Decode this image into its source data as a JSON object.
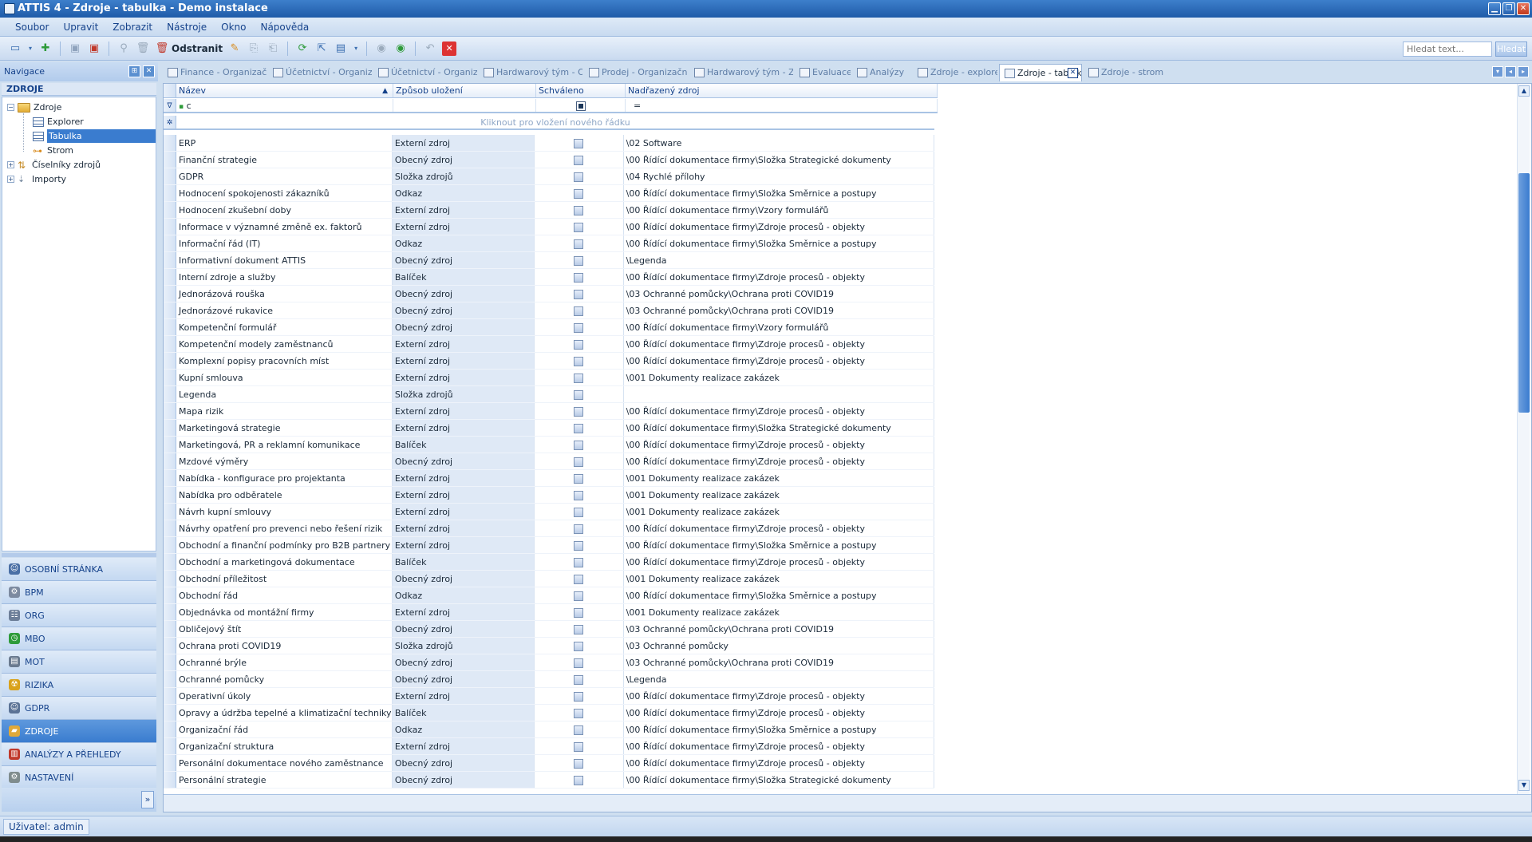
{
  "window": {
    "title": "ATTIS 4 - Zdroje - tabulka - Demo instalace"
  },
  "menu": [
    "Soubor",
    "Upravit",
    "Zobrazit",
    "Nástroje",
    "Okno",
    "Nápověda"
  ],
  "toolbar": {
    "delete_label": "Odstranit",
    "search_placeholder": "Hledat text...",
    "search_button": "Hledat"
  },
  "nav": {
    "title": "Navigace",
    "section": "ZDROJE",
    "tree": [
      {
        "label": "Zdroje"
      },
      {
        "label": "Explorer"
      },
      {
        "label": "Tabulka"
      },
      {
        "label": "Strom"
      },
      {
        "label": "Číselníky zdrojů"
      },
      {
        "label": "Importy"
      }
    ],
    "modules": [
      {
        "label": "OSOBNÍ STRÁNKA",
        "color": "#4a6fa5"
      },
      {
        "label": "BPM",
        "color": "#7c8aa0"
      },
      {
        "label": "ORG",
        "color": "#6d7f99"
      },
      {
        "label": "MBO",
        "color": "#2e9b3a"
      },
      {
        "label": "MOT",
        "color": "#6a7a8f"
      },
      {
        "label": "RIZIKA",
        "color": "#d9a21c"
      },
      {
        "label": "GDPR",
        "color": "#5b7396"
      },
      {
        "label": "ZDROJE",
        "color": "#e0a93a"
      },
      {
        "label": "ANALÝZY A PŘEHLEDY",
        "color": "#c0392b"
      },
      {
        "label": "NASTAVENÍ",
        "color": "#7f8c8d"
      }
    ]
  },
  "tabs": [
    {
      "label": "Finance - Organizační je"
    },
    {
      "label": "Účetnictví - Organizační"
    },
    {
      "label": "Účetnictví - Organizační"
    },
    {
      "label": "Hardwarový tým - Orga"
    },
    {
      "label": "Prodej - Organizační jec"
    },
    {
      "label": "Hardwarový tým - Zařa"
    },
    {
      "label": "Evaluace"
    },
    {
      "label": "Analýzy"
    },
    {
      "label": "Zdroje - explorer"
    },
    {
      "label": "Zdroje - tabulka"
    },
    {
      "label": "Zdroje - strom"
    }
  ],
  "grid": {
    "columns": [
      "Název",
      "Způsob uložení",
      "Schváleno",
      "Nadřazený zdroj"
    ],
    "filter_name_value": "c",
    "filter_parent_value": "=",
    "new_row_text": "Kliknout pro vložení nového řádku",
    "rows": [
      [
        "ERP",
        "Externí zdroj",
        "\\02 Software"
      ],
      [
        "Finanční strategie",
        "Obecný zdroj",
        "\\00 Řídící dokumentace firmy\\Složka Strategické dokumenty"
      ],
      [
        "GDPR",
        "Složka zdrojů",
        "\\04 Rychlé přílohy"
      ],
      [
        "Hodnocení spokojenosti zákazníků",
        "Odkaz",
        "\\00 Řídící dokumentace firmy\\Složka Směrnice a postupy"
      ],
      [
        "Hodnocení zkušební doby",
        "Externí zdroj",
        "\\00 Řídící dokumentace firmy\\Vzory formulářů"
      ],
      [
        "Informace v významné změně ex. faktorů",
        "Externí zdroj",
        "\\00 Řídící dokumentace firmy\\Zdroje procesů - objekty"
      ],
      [
        "Informační řád (IT)",
        "Odkaz",
        "\\00 Řídící dokumentace firmy\\Složka Směrnice a postupy"
      ],
      [
        "Informativní dokument ATTIS",
        "Obecný zdroj",
        "\\Legenda"
      ],
      [
        "Interní zdroje a služby",
        "Balíček",
        "\\00 Řídící dokumentace firmy\\Zdroje procesů - objekty"
      ],
      [
        "Jednorázová rouška",
        "Obecný zdroj",
        "\\03 Ochranné pomůcky\\Ochrana proti COVID19"
      ],
      [
        "Jednorázové rukavice",
        "Obecný zdroj",
        "\\03 Ochranné pomůcky\\Ochrana proti COVID19"
      ],
      [
        "Kompetenční formulář",
        "Obecný zdroj",
        "\\00 Řídící dokumentace firmy\\Vzory formulářů"
      ],
      [
        "Kompetenční modely zaměstnanců",
        "Externí zdroj",
        "\\00 Řídící dokumentace firmy\\Zdroje procesů - objekty"
      ],
      [
        "Komplexní popisy pracovních míst",
        "Externí zdroj",
        "\\00 Řídící dokumentace firmy\\Zdroje procesů - objekty"
      ],
      [
        "Kupní smlouva",
        "Externí zdroj",
        "\\001 Dokumenty realizace zakázek"
      ],
      [
        "Legenda",
        "Složka zdrojů",
        ""
      ],
      [
        "Mapa rizik",
        "Externí zdroj",
        "\\00 Řídící dokumentace firmy\\Zdroje procesů - objekty"
      ],
      [
        "Marketingová strategie",
        "Externí zdroj",
        "\\00 Řídící dokumentace firmy\\Složka Strategické dokumenty"
      ],
      [
        "Marketingová, PR a reklamní komunikace",
        "Balíček",
        "\\00 Řídící dokumentace firmy\\Zdroje procesů - objekty"
      ],
      [
        "Mzdové výměry",
        "Obecný zdroj",
        "\\00 Řídící dokumentace firmy\\Zdroje procesů - objekty"
      ],
      [
        "Nabídka - konfigurace pro projektanta",
        "Externí zdroj",
        "\\001 Dokumenty realizace zakázek"
      ],
      [
        "Nabídka pro odběratele",
        "Externí zdroj",
        "\\001 Dokumenty realizace zakázek"
      ],
      [
        "Návrh kupní smlouvy",
        "Externí zdroj",
        "\\001 Dokumenty realizace zakázek"
      ],
      [
        "Návrhy opatření pro prevenci nebo řešení rizik",
        "Externí zdroj",
        "\\00 Řídící dokumentace firmy\\Zdroje procesů - objekty"
      ],
      [
        "Obchodní a finanční podmínky pro B2B partnery",
        "Externí zdroj",
        "\\00 Řídící dokumentace firmy\\Složka Směrnice a postupy"
      ],
      [
        "Obchodní a marketingová dokumentace",
        "Balíček",
        "\\00 Řídící dokumentace firmy\\Zdroje procesů - objekty"
      ],
      [
        "Obchodní příležitost",
        "Obecný zdroj",
        "\\001 Dokumenty realizace zakázek"
      ],
      [
        "Obchodní řád",
        "Odkaz",
        "\\00 Řídící dokumentace firmy\\Složka Směrnice a postupy"
      ],
      [
        "Objednávka od montážní firmy",
        "Externí zdroj",
        "\\001 Dokumenty realizace zakázek"
      ],
      [
        "Obličejový štít",
        "Obecný zdroj",
        "\\03 Ochranné pomůcky\\Ochrana proti COVID19"
      ],
      [
        "Ochrana proti COVID19",
        "Složka zdrojů",
        "\\03 Ochranné pomůcky"
      ],
      [
        "Ochranné brýle",
        "Obecný zdroj",
        "\\03 Ochranné pomůcky\\Ochrana proti COVID19"
      ],
      [
        "Ochranné pomůcky",
        "Obecný zdroj",
        "\\Legenda"
      ],
      [
        "Operativní úkoly",
        "Externí zdroj",
        "\\00 Řídící dokumentace firmy\\Zdroje procesů - objekty"
      ],
      [
        "Opravy a údržba tepelné a klimatizační techniky",
        "Balíček",
        "\\00 Řídící dokumentace firmy\\Zdroje procesů - objekty"
      ],
      [
        "Organizační řád",
        "Odkaz",
        "\\00 Řídící dokumentace firmy\\Složka Směrnice a postupy"
      ],
      [
        "Organizační struktura",
        "Externí zdroj",
        "\\00 Řídící dokumentace firmy\\Zdroje procesů - objekty"
      ],
      [
        "Personální dokumentace nového zaměstnance",
        "Obecný zdroj",
        "\\00 Řídící dokumentace firmy\\Zdroje procesů - objekty"
      ],
      [
        "Personální strategie",
        "Obecný zdroj",
        "\\00 Řídící dokumentace firmy\\Složka Strategické dokumenty"
      ]
    ]
  },
  "status": {
    "user": "Uživatel: admin"
  }
}
